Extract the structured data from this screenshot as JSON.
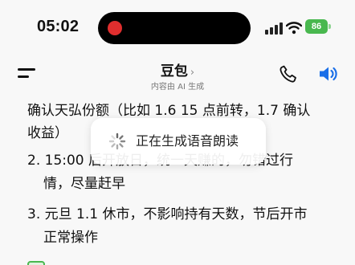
{
  "status_bar": {
    "time": "05:02",
    "battery_level": "86",
    "icons": [
      "recording-dot-icon",
      "cellular-signal-icon",
      "wifi-icon",
      "battery-icon"
    ]
  },
  "header": {
    "title": "豆包",
    "title_chevron": "›",
    "subtitle": "内容由 AI 生成",
    "icons": [
      "menu-icon",
      "phone-icon",
      "speaker-icon"
    ],
    "accent_color": "#1a6fe8"
  },
  "message": {
    "lines": [
      "确认天弘份额（比如 1.6 15 点前转，1.7 确认",
      "收益）",
      "2. 15:00 后开放日，统一天赚的，勿错过行",
      "情，尽量赶早",
      "3. 元旦 1.1 休市，不影响持有天数，节后开市",
      "正常操作"
    ]
  },
  "toast": {
    "text": "正在生成语音朗读",
    "icon": "loading-spinner-icon"
  }
}
